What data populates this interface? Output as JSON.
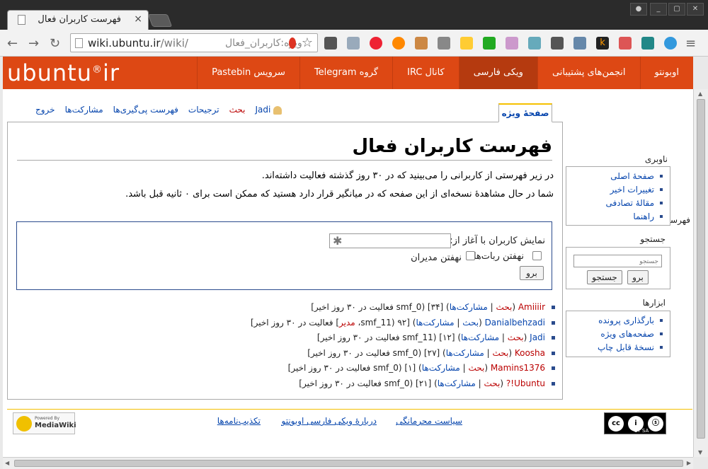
{
  "browser": {
    "tab_title": "فهرست کاربران فعال",
    "tab_close": "×",
    "url_host": "wiki.ubuntu.ir",
    "url_path": "/wiki/",
    "url_rtl": "ویژه:کاربران_فعال",
    "star": "☆",
    "win_min": "_",
    "win_max": "▢",
    "win_close": "✕",
    "win_user": "●"
  },
  "site": {
    "logo_text": "ubuntu",
    "logo_mark": "®",
    "logo_suffix": "ir",
    "nav": [
      "اوبونتو",
      "انجمن‌های پشتیبانی",
      "ویکی فارسی",
      "کانال IRC",
      "گروه Telegram",
      "سرویس Pastebin"
    ],
    "nav_active_index": 2
  },
  "personal": {
    "user": "Jadi",
    "talk": "بحث",
    "preferences": "ترجیحات",
    "watchlist": "فهرست پی‌گیری‌ها",
    "contributions": "مشارکت‌ها",
    "logout": "خروج"
  },
  "tab_special": "صفحهٔ ویژه",
  "page": {
    "title": "فهرست کاربران فعال",
    "intro": "در زیر فهرستی از کاربرانی را می‌بینید که در ۳۰ روز گذشته فعالیت داشته‌اند.",
    "intro2": "شما در حال مشاهدهٔ نسخه‌ای از این صفحه که در میانگیر قرار دارد هستید که ممکن است برای ۰ ثانیه قبل باشد."
  },
  "filter": {
    "legend": "فهرست کاربران فعال",
    "start_label": "نمایش کاربران با آغاز از:",
    "start_placeholder": "✱",
    "hide_bots": "نهفتن ربات‌ها",
    "hide_admins": "نهفتن مدیران",
    "go": "برو"
  },
  "users": [
    {
      "name": "Amiiiir",
      "link_red": true,
      "talk": "بحث",
      "contribs": "مشارکت‌ها",
      "rest": " [۳۴] (smf_0 فعالیت در ۳۰ روز اخیر]"
    },
    {
      "name": "Danialbehzadi",
      "link_red": false,
      "talk": "بحث",
      "contribs": "مشارکت‌ها",
      "rest": " [۹۲ (smf_11، ",
      "role": "مدیر",
      "rest2": "] فعالیت در ۳۰ روز اخیر]"
    },
    {
      "name": "Jadi",
      "link_red": false,
      "talk": "بحث",
      "contribs": "مشارکت‌ها",
      "rest": " [۱۲] (smf_11 فعالیت در ۳۰ روز اخیر]"
    },
    {
      "name": "Koosha",
      "link_red": true,
      "talk": "بحث",
      "contribs": "مشارکت‌ها",
      "rest": " [۲۷] (smf_0 فعالیت در ۳۰ روز اخیر]"
    },
    {
      "name": "Mamins1376",
      "link_red": true,
      "talk": "بحث",
      "contribs": "مشارکت‌ها",
      "rest": " [۱] (smf_0 فعالیت در ۳۰ روز اخیر]"
    },
    {
      "name": "Ubuntu!?",
      "link_red": true,
      "talk": "بحث",
      "contribs": "مشارکت‌ها",
      "rest": " [۲۱] (smf_0 فعالیت در ۳۰ روز اخیر]"
    }
  ],
  "sidebar": {
    "nav_heading": "ناوبری",
    "nav_items": [
      "صفحهٔ اصلی",
      "تغییرات اخیر",
      "مقالهٔ تصادفی",
      "راهنما"
    ],
    "search_heading": "جستجو",
    "search_placeholder": "جستجو",
    "search_go": "برو",
    "search_button": "جستجو",
    "tools_heading": "ابزارها",
    "tools_items": [
      "بارگذاری پرونده",
      "صفحه‌های ویژه",
      "نسخهٔ قابل چاپ"
    ]
  },
  "footer": {
    "privacy": "سیاست محرمانگی",
    "about": "دربارهٔ ویکی فارسی اوبونتو",
    "disclaimers": "تکذیب‌نامه‌ها",
    "cc_label": "BY   SA",
    "cc_c": "cc",
    "cc_i": "i",
    "cc_s": "ⓢ",
    "mw_powered": "Powered By",
    "mw_name": "MediaWiki"
  }
}
